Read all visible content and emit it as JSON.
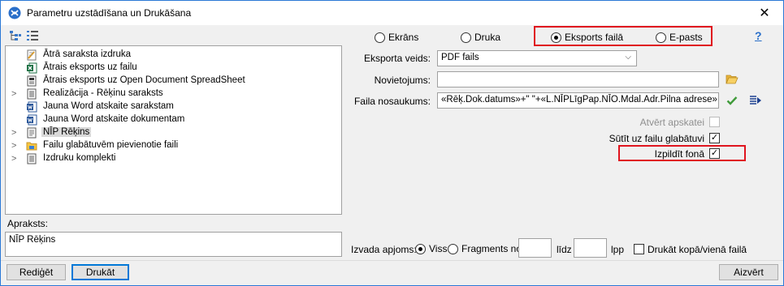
{
  "window": {
    "title": "Parametru uzstādīšana un Drukāšana",
    "close_symbol": "✕"
  },
  "toolbar": {
    "icons": [
      "tree-view-icon",
      "list-view-icon"
    ]
  },
  "tree": {
    "items": [
      {
        "label": "Ātrā saraksta izdruka",
        "icon": "quick-print-icon",
        "expandable": false,
        "selected": false
      },
      {
        "label": "Ātrais eksports uz failu",
        "icon": "excel-icon",
        "expandable": false,
        "selected": false
      },
      {
        "label": "Ātrais eksports uz Open Document SpreadSheet",
        "icon": "ods-icon",
        "expandable": false,
        "selected": false
      },
      {
        "label": "Realizācija - Rēķinu saraksts",
        "icon": "report-list-icon",
        "expandable": true,
        "selected": false
      },
      {
        "label": "Jauna Word atskaite sarakstam",
        "icon": "word-icon",
        "expandable": false,
        "selected": false
      },
      {
        "label": "Jauna Word atskaite dokumentam",
        "icon": "word-icon",
        "expandable": false,
        "selected": false
      },
      {
        "label": "NĪP Rēķins",
        "icon": "document-icon",
        "expandable": true,
        "selected": true
      },
      {
        "label": "Failu glabātuvēm pievienotie faili",
        "icon": "folder-icon",
        "expandable": true,
        "selected": false
      },
      {
        "label": "Izdruku komplekti",
        "icon": "report-list-icon",
        "expandable": true,
        "selected": false
      }
    ]
  },
  "description": {
    "label": "Apraksts:",
    "value": "NĪP Rēķins"
  },
  "output_mode": {
    "options": [
      "Ekrāns",
      "Druka",
      "Eksports failā",
      "E-pasts"
    ],
    "selected": "Eksports failā"
  },
  "help_symbol": "?",
  "export": {
    "type_label": "Eksporta veids:",
    "type_value": "PDF fails",
    "location_label": "Novietojums:",
    "location_value": "",
    "filename_label": "Faila nosaukums:",
    "filename_value": "«Rēķ.Dok.datums»+\" \"+«L.NĪPLīgPap.NĪO.Mdal.Adr.Pilna adrese»"
  },
  "options": {
    "open_view_label": "Atvērt apskatei",
    "open_view_checked": false,
    "send_to_storage_label": "Sūtīt uz failu glabātuvi",
    "send_to_storage_checked": true,
    "background_label": "Izpildīt fonā",
    "background_checked": true
  },
  "scope": {
    "label": "Izvada apjoms:",
    "all_label": "Viss",
    "fragments_label": "Fragments no",
    "selected": "Viss",
    "from_value": "",
    "to_label": "līdz",
    "to_value": "",
    "pages_label": "lpp",
    "print_together_label": "Drukāt kopā/vienā failā",
    "print_together_checked": false
  },
  "buttons": {
    "edit": "Rediģēt",
    "print": "Drukāt",
    "close": "Aizvērt"
  },
  "colors": {
    "highlight_red": "#e0141e",
    "accent_blue": "#0078d7"
  }
}
